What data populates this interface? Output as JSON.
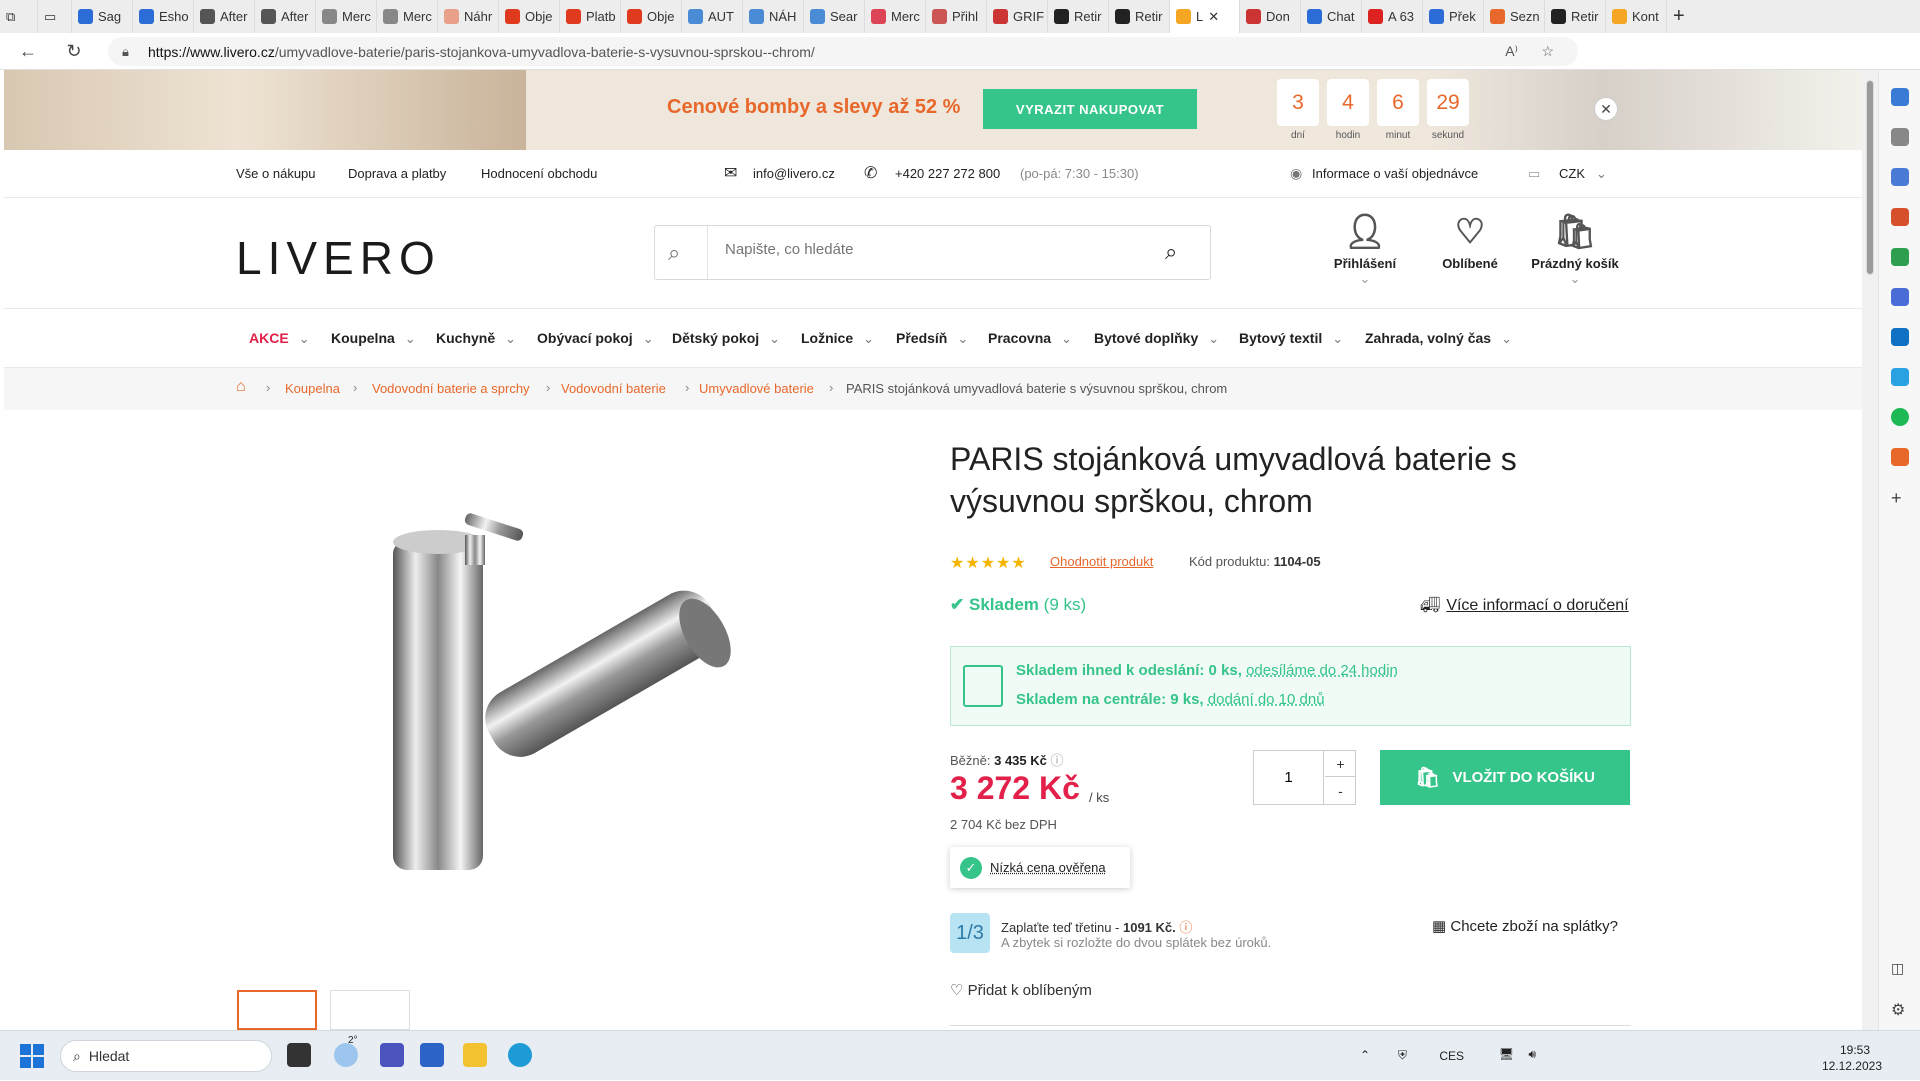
{
  "browser": {
    "tabs": [
      "Sag",
      "Esho",
      "After",
      "After",
      "Merc",
      "Merc",
      "Náhr",
      "Obje",
      "Platb",
      "Obje",
      "AUT",
      "NÁH",
      "Sear",
      "Merc",
      "Přihl",
      "GRIF",
      "Retir",
      "Retir",
      "L",
      "Don",
      "Chat",
      "A 63",
      "Přek",
      "Sezn",
      "Retir",
      "Kont"
    ],
    "url_domain": "https://www.livero.cz",
    "url_path": "/umyvadlove-baterie/paris-stojankova-umyvadlova-baterie-s-vysuvnou-sprskou--chrom/"
  },
  "banner": {
    "text": "Cenové bomby a slevy až 52 %",
    "button": "VYRAZIT NAKUPOVAT",
    "countdown": [
      {
        "v": "3",
        "l": "dní"
      },
      {
        "v": "4",
        "l": "hodin"
      },
      {
        "v": "6",
        "l": "minut"
      },
      {
        "v": "29",
        "l": "sekund"
      }
    ]
  },
  "infobar": {
    "links": [
      "Vše o nákupu",
      "Doprava a platby",
      "Hodnocení obchodu"
    ],
    "email": "info@livero.cz",
    "phone": "+420 227 272 800",
    "hours": "(po-pá: 7:30 - 15:30)",
    "order_info": "Informace o vaší objednávce",
    "currency": "CZK"
  },
  "header": {
    "logo": "LIVERO",
    "search_placeholder": "Napište, co hledáte",
    "login": "Přihlášení",
    "favorites": "Oblíbené",
    "cart": "Prázdný košík"
  },
  "nav": [
    "AKCE",
    "Koupelna",
    "Kuchyně",
    "Obývací pokoj",
    "Dětský pokoj",
    "Ložnice",
    "Předsíň",
    "Pracovna",
    "Bytové doplňky",
    "Bytový textil",
    "Zahrada, volný čas"
  ],
  "breadcrumb": [
    "Koupelna",
    "Vodovodní baterie a sprchy",
    "Vodovodní baterie",
    "Umyvadlové baterie",
    "PARIS stojánková umyvadlová baterie s výsuvnou sprškou, chrom"
  ],
  "product": {
    "title": "PARIS stojánková umyvadlová baterie s výsuvnou sprškou, chrom",
    "rating_stars": 5,
    "rate_link": "Ohodnotit produkt",
    "code_label": "Kód produktu:",
    "code": "1104-05",
    "stock": "Skladem",
    "stock_count": "(9 ks)",
    "delivery_link": "Více informací o doručení",
    "stock_line1_a": "Skladem ihned k odeslání: 0 ks,",
    "stock_line1_b": "odesíláme do 24 hodin",
    "stock_line2_a": "Skladem na centrále: 9 ks,",
    "stock_line2_b": "dodání do 10 dnů",
    "regular_label": "Běžně:",
    "regular_price": "3 435 Kč",
    "price": "3 272 Kč",
    "price_unit": "/ ks",
    "price_no_vat": "2 704 Kč bez DPH",
    "qty": "1",
    "add_to_cart": "VLOŽIT DO KOŠÍKU",
    "low_price": "Nízká cena ověřena",
    "third_icon": "1/3",
    "third_text": "Zaplaťte teď třetinu - ",
    "third_amount": "1091 Kč.",
    "third_sub": "A zbytek si rozložte do dvou splátek bez úroků.",
    "installments": "Chcete zboží na splátky?",
    "add_favorite": "Přidat k oblíbeným"
  },
  "taskbar": {
    "search": "Hledat",
    "lang": "CES",
    "time": "19:53",
    "date": "12.12.2023",
    "weather": "2°"
  }
}
